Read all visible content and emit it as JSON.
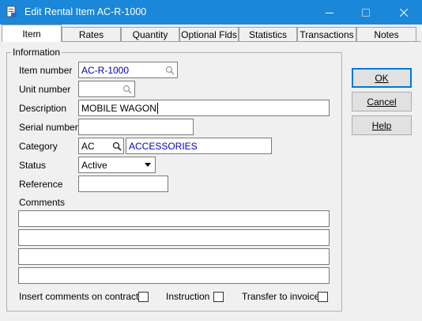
{
  "window": {
    "title": "Edit Rental Item AC-R-1000"
  },
  "tabs": [
    {
      "label": "Item"
    },
    {
      "label": "Rates"
    },
    {
      "label": "Quantity"
    },
    {
      "label": "Optional Flds"
    },
    {
      "label": "Statistics"
    },
    {
      "label": "Transactions"
    },
    {
      "label": "Notes"
    }
  ],
  "group": {
    "label": "Information"
  },
  "fields": {
    "item_number": {
      "label": "Item number",
      "value": "AC-R-1000"
    },
    "unit_number": {
      "label": "Unit number",
      "value": ""
    },
    "description": {
      "label": "Description",
      "value": "MOBILE WAGON"
    },
    "serial_number": {
      "label": "Serial number",
      "value": ""
    },
    "category": {
      "label": "Category",
      "code": "AC",
      "name": "ACCESSORIES"
    },
    "status": {
      "label": "Status",
      "value": "Active"
    },
    "reference": {
      "label": "Reference",
      "value": ""
    },
    "comments": {
      "label": "Comments",
      "lines": [
        "",
        "",
        "",
        ""
      ]
    }
  },
  "checkboxes": [
    {
      "label": "Insert comments on contracts",
      "checked": false
    },
    {
      "label": "Instruction",
      "checked": false
    },
    {
      "label": "Transfer to invoice",
      "checked": false
    }
  ],
  "buttons": {
    "ok": "OK",
    "cancel": "Cancel",
    "help": "Help"
  },
  "colors": {
    "titlebar": "#1a87d9",
    "link_value": "#0000c0"
  }
}
